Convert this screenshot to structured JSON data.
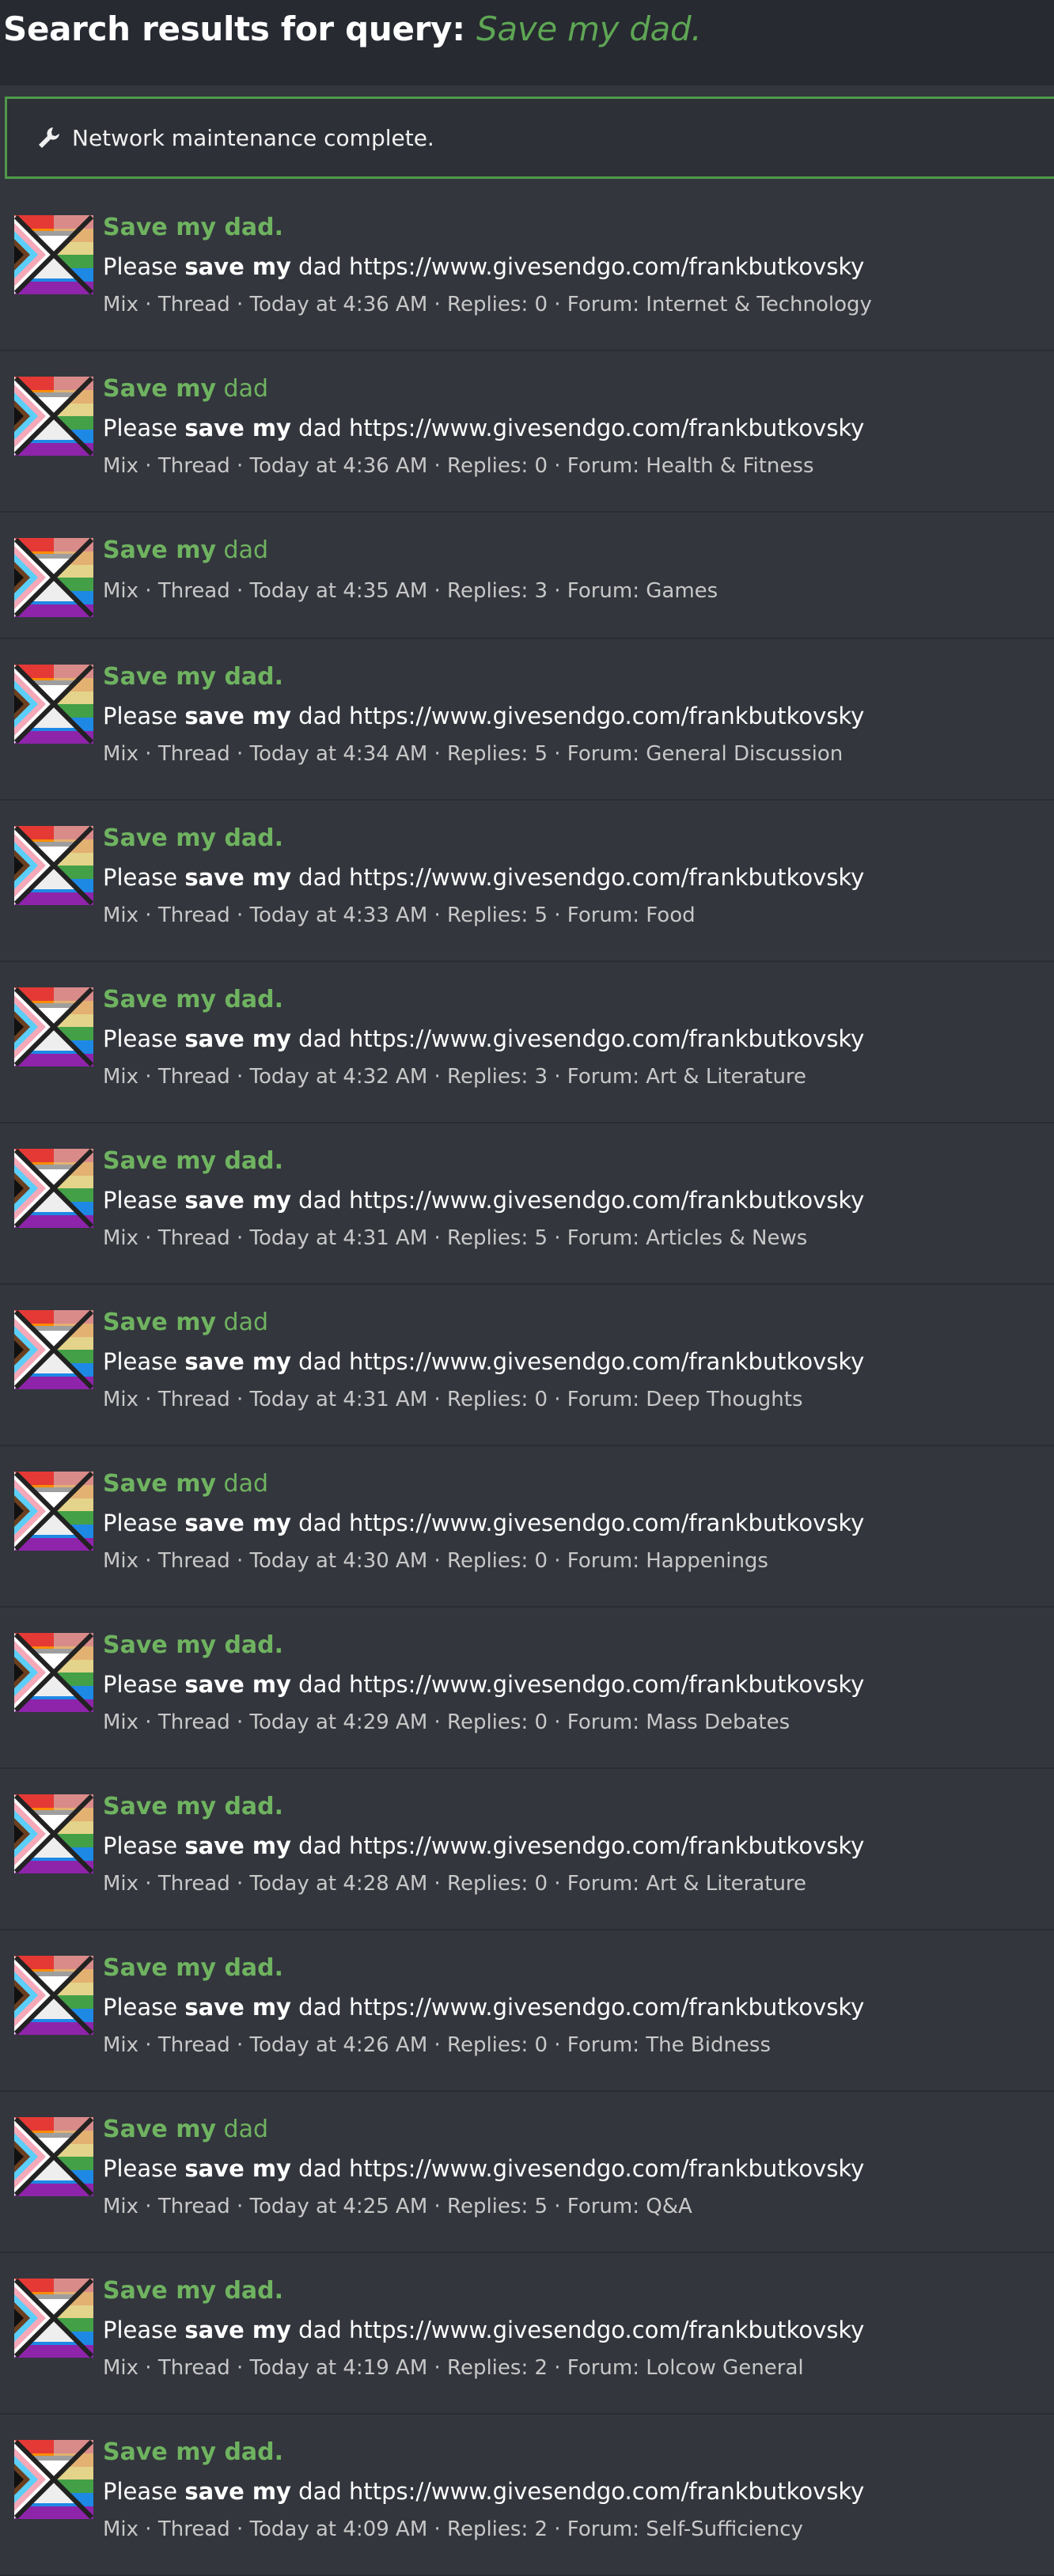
{
  "header": {
    "title_prefix": "Search results for query:",
    "query": "Save my dad."
  },
  "notice": {
    "icon": "wrench-icon",
    "text": "Network maintenance complete."
  },
  "colors": {
    "accent_green": "#6fb360",
    "background": "#33363d",
    "header_bg": "#272a30"
  },
  "results": [
    {
      "title_bold": "Save my dad.",
      "title_rest": "",
      "snippet_pre": "Please ",
      "snippet_bold": "save my",
      "snippet_post": " dad https://www.givesendgo.com/frankbutkovsky",
      "meta": "Mix · Thread · Today at 4:36 AM · Replies: 0 · Forum: Internet & Technology"
    },
    {
      "title_bold": "Save my",
      "title_rest": " dad",
      "snippet_pre": "Please ",
      "snippet_bold": "save my",
      "snippet_post": " dad https://www.givesendgo.com/frankbutkovsky",
      "meta": "Mix · Thread · Today at 4:36 AM · Replies: 0 · Forum: Health & Fitness"
    },
    {
      "title_bold": "Save my",
      "title_rest": " dad",
      "snippet_pre": "",
      "snippet_bold": "",
      "snippet_post": "",
      "meta": "Mix · Thread · Today at 4:35 AM · Replies: 3 · Forum: Games"
    },
    {
      "title_bold": "Save my dad.",
      "title_rest": "",
      "snippet_pre": "Please ",
      "snippet_bold": "save my",
      "snippet_post": " dad https://www.givesendgo.com/frankbutkovsky",
      "meta": "Mix · Thread · Today at 4:34 AM · Replies: 5 · Forum: General Discussion"
    },
    {
      "title_bold": "Save my dad.",
      "title_rest": "",
      "snippet_pre": "Please ",
      "snippet_bold": "save my",
      "snippet_post": " dad https://www.givesendgo.com/frankbutkovsky",
      "meta": "Mix · Thread · Today at 4:33 AM · Replies: 5 · Forum: Food"
    },
    {
      "title_bold": "Save my dad.",
      "title_rest": "",
      "snippet_pre": "Please ",
      "snippet_bold": "save my",
      "snippet_post": " dad https://www.givesendgo.com/frankbutkovsky",
      "meta": "Mix · Thread · Today at 4:32 AM · Replies: 3 · Forum: Art & Literature"
    },
    {
      "title_bold": "Save my dad.",
      "title_rest": "",
      "snippet_pre": "Please ",
      "snippet_bold": "save my",
      "snippet_post": " dad https://www.givesendgo.com/frankbutkovsky",
      "meta": "Mix · Thread · Today at 4:31 AM · Replies: 5 · Forum: Articles & News"
    },
    {
      "title_bold": "Save my",
      "title_rest": " dad",
      "snippet_pre": "Please ",
      "snippet_bold": "save my",
      "snippet_post": " dad https://www.givesendgo.com/frankbutkovsky",
      "meta": "Mix · Thread · Today at 4:31 AM · Replies: 0 · Forum: Deep Thoughts"
    },
    {
      "title_bold": "Save my",
      "title_rest": " dad",
      "snippet_pre": "Please ",
      "snippet_bold": "save my",
      "snippet_post": " dad https://www.givesendgo.com/frankbutkovsky",
      "meta": "Mix · Thread · Today at 4:30 AM · Replies: 0 · Forum: Happenings"
    },
    {
      "title_bold": "Save my dad.",
      "title_rest": "",
      "snippet_pre": "Please ",
      "snippet_bold": "save my",
      "snippet_post": " dad https://www.givesendgo.com/frankbutkovsky",
      "meta": "Mix · Thread · Today at 4:29 AM · Replies: 0 · Forum: Mass Debates"
    },
    {
      "title_bold": "Save my dad.",
      "title_rest": "",
      "snippet_pre": "Please ",
      "snippet_bold": "save my",
      "snippet_post": " dad https://www.givesendgo.com/frankbutkovsky",
      "meta": "Mix · Thread · Today at 4:28 AM · Replies: 0 · Forum: Art & Literature"
    },
    {
      "title_bold": "Save my dad.",
      "title_rest": "",
      "snippet_pre": "Please ",
      "snippet_bold": "save my",
      "snippet_post": " dad https://www.givesendgo.com/frankbutkovsky",
      "meta": "Mix · Thread · Today at 4:26 AM · Replies: 0 · Forum: The Bidness"
    },
    {
      "title_bold": "Save my",
      "title_rest": " dad",
      "snippet_pre": "Please ",
      "snippet_bold": "save my",
      "snippet_post": " dad https://www.givesendgo.com/frankbutkovsky",
      "meta": "Mix · Thread · Today at 4:25 AM · Replies: 5 · Forum: Q&A"
    },
    {
      "title_bold": "Save my dad.",
      "title_rest": "",
      "snippet_pre": "Please ",
      "snippet_bold": "save my",
      "snippet_post": " dad https://www.givesendgo.com/frankbutkovsky",
      "meta": "Mix · Thread · Today at 4:19 AM · Replies: 2 · Forum: Lolcow General"
    },
    {
      "title_bold": "Save my dad.",
      "title_rest": "",
      "snippet_pre": "Please ",
      "snippet_bold": "save my",
      "snippet_post": " dad https://www.givesendgo.com/frankbutkovsky",
      "meta": "Mix · Thread · Today at 4:09 AM · Replies: 2 · Forum: Self-Sufficiency"
    }
  ]
}
